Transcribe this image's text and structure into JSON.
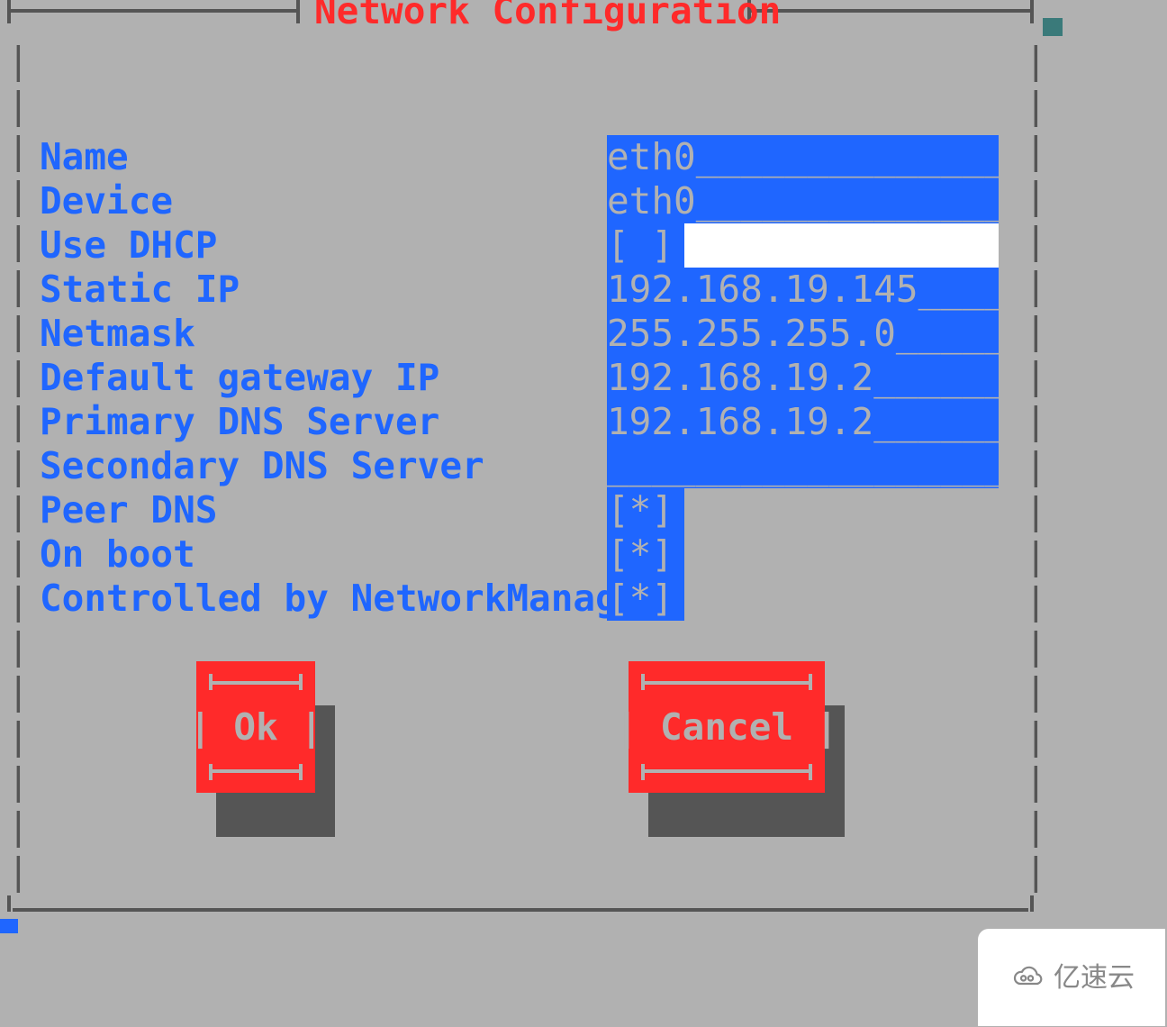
{
  "title": "Network Configuration",
  "side_char_column": "|\n|\n|\n|\n|\n|\n|\n|\n|\n|\n|\n|\n|\n|\n|\n|\n|\n|\n|",
  "fields": {
    "name": {
      "label": "Name",
      "value": "eth0________________"
    },
    "device": {
      "label": "Device",
      "value": "eth0________________"
    },
    "use_dhcp": {
      "label": "Use DHCP",
      "value": "[ ]"
    },
    "static_ip": {
      "label": "Static IP",
      "value": "192.168.19.145______"
    },
    "netmask": {
      "label": "Netmask",
      "value": "255.255.255.0_______"
    },
    "gateway": {
      "label": "Default gateway IP",
      "value": "192.168.19.2________"
    },
    "dns1": {
      "label": "Primary DNS Server",
      "value": "192.168.19.2________"
    },
    "dns2": {
      "label": "Secondary DNS Server",
      "value": "____________________"
    },
    "peer_dns": {
      "label": "Peer DNS",
      "value": "[*]"
    },
    "on_boot": {
      "label": "On boot",
      "value": "[*]"
    },
    "nm": {
      "label": "Controlled by NetworkManager",
      "value": "[*]"
    }
  },
  "buttons": {
    "ok": {
      "label": "| Ok |"
    },
    "cancel": {
      "label": "| Cancel |"
    }
  },
  "watermark": "亿速云"
}
